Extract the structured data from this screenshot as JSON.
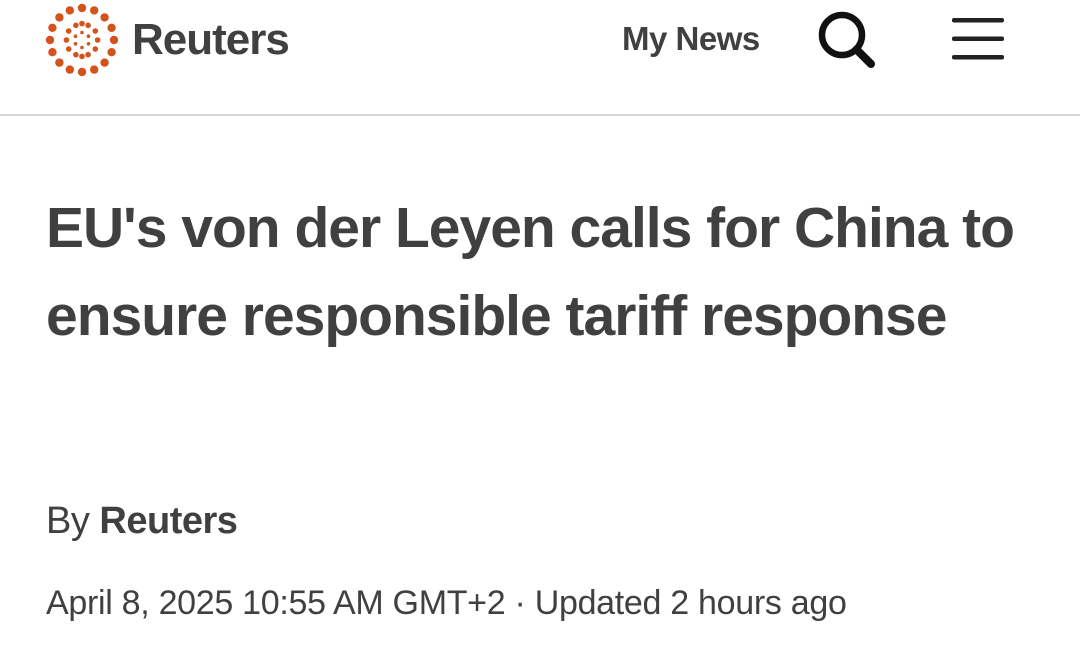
{
  "header": {
    "logo_text": "Reuters",
    "logo_color": "#d4521c",
    "my_news_label": "My News",
    "search_icon": "search-icon",
    "menu_icon": "hamburger-menu-icon"
  },
  "article": {
    "headline": "EU's von der Leyen calls for China to ensure responsible tariff response",
    "byline_prefix": "By",
    "author": "Reuters",
    "published": "April 8, 2025 10:55 AM GMT+2",
    "separator": "·",
    "updated": "Updated 2 hours ago"
  },
  "colors": {
    "text": "#404040",
    "divider": "#d6d6d6",
    "brand_orange": "#d4521c"
  }
}
